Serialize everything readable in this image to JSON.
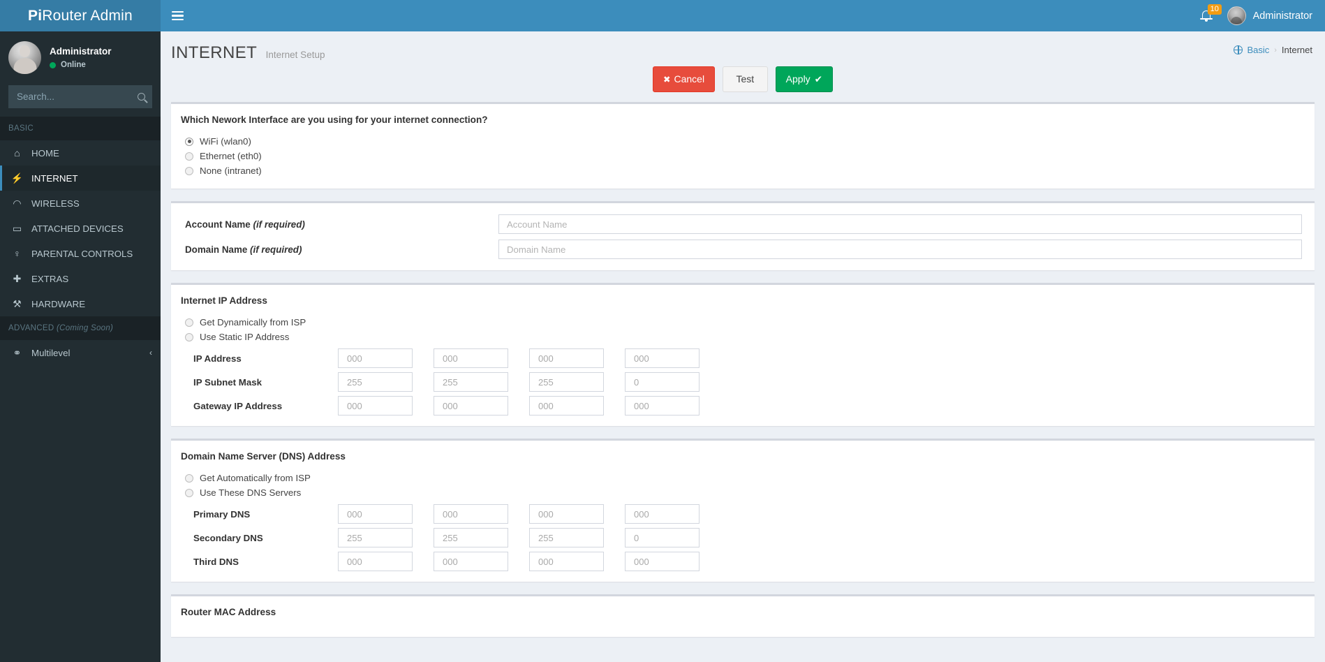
{
  "brand": {
    "prefix": "Pi",
    "rest": "Router Admin"
  },
  "navbar": {
    "toggle_label": "Toggle navigation",
    "notifications_count": "10",
    "user_name": "Administrator"
  },
  "sidebar": {
    "user": {
      "name": "Administrator",
      "status": "Online"
    },
    "search": {
      "placeholder": "Search...",
      "value": ""
    },
    "section_basic": "BASIC",
    "section_advanced": "ADVANCED",
    "section_advanced_note": "(Coming Soon)",
    "items": [
      {
        "label": "HOME",
        "icon": "home-icon",
        "glyph": "⌂"
      },
      {
        "label": "INTERNET",
        "icon": "plug-icon",
        "glyph": "⚡"
      },
      {
        "label": "WIRELESS",
        "icon": "wifi-icon",
        "glyph": "◠"
      },
      {
        "label": "ATTACHED DEVICES",
        "icon": "laptop-icon",
        "glyph": "▭"
      },
      {
        "label": "PARENTAL CONTROLS",
        "icon": "child-icon",
        "glyph": "♀"
      },
      {
        "label": "EXTRAS",
        "icon": "plus-icon",
        "glyph": "✚"
      },
      {
        "label": "HARDWARE",
        "icon": "wrench-icon",
        "glyph": "⚒"
      }
    ],
    "multilevel": {
      "label": "Multilevel",
      "icon": "link-icon",
      "glyph": "⚭",
      "chevron": "‹"
    }
  },
  "header": {
    "title": "INTERNET",
    "subtitle": "Internet Setup",
    "breadcrumb": {
      "root": "Basic",
      "separator": "›",
      "current": "Internet"
    }
  },
  "actions": {
    "cancel": {
      "label": "Cancel",
      "icon": "✖"
    },
    "test": {
      "label": "Test"
    },
    "apply": {
      "label": "Apply",
      "icon": "✔"
    }
  },
  "interface_section": {
    "question": "Which Nework Interface are you using for your internet connection?",
    "options": [
      {
        "label": "WiFi (wlan0)",
        "checked": true
      },
      {
        "label": "Ethernet (eth0)",
        "checked": false
      },
      {
        "label": "None (intranet)",
        "checked": false
      }
    ]
  },
  "account_section": {
    "account_label": "Account Name",
    "account_label_note": "(if required)",
    "account_placeholder": "Account Name",
    "account_value": "",
    "domain_label": "Domain Name",
    "domain_label_note": "(if required)",
    "domain_placeholder": "Domain Name",
    "domain_value": ""
  },
  "ip_section": {
    "title": "Internet IP Address",
    "options": [
      {
        "label": "Get Dynamically from ISP",
        "checked": false
      },
      {
        "label": "Use Static IP Address",
        "checked": false
      }
    ],
    "rows": [
      {
        "label": "IP Address",
        "octets": [
          "000",
          "000",
          "000",
          "000"
        ]
      },
      {
        "label": "IP Subnet Mask",
        "octets": [
          "255",
          "255",
          "255",
          "0"
        ]
      },
      {
        "label": "Gateway IP Address",
        "octets": [
          "000",
          "000",
          "000",
          "000"
        ]
      }
    ]
  },
  "dns_section": {
    "title": "Domain Name Server (DNS) Address",
    "options": [
      {
        "label": "Get Automatically from ISP",
        "checked": false
      },
      {
        "label": "Use These DNS Servers",
        "checked": false
      }
    ],
    "rows": [
      {
        "label": "Primary DNS",
        "octets": [
          "000",
          "000",
          "000",
          "000"
        ]
      },
      {
        "label": "Secondary DNS",
        "octets": [
          "255",
          "255",
          "255",
          "0"
        ]
      },
      {
        "label": "Third DNS",
        "octets": [
          "000",
          "000",
          "000",
          "000"
        ]
      }
    ]
  },
  "mac_section": {
    "title": "Router MAC Address"
  },
  "colors": {
    "brand_blue": "#3c8dbc",
    "brand_blue_dark": "#357ca5",
    "sidebar_bg": "#222d32",
    "sidebar_active": "#1e282c",
    "content_bg": "#ecf0f5",
    "danger": "#e74c3c",
    "success": "#00a65a",
    "warning": "#f39c12"
  }
}
